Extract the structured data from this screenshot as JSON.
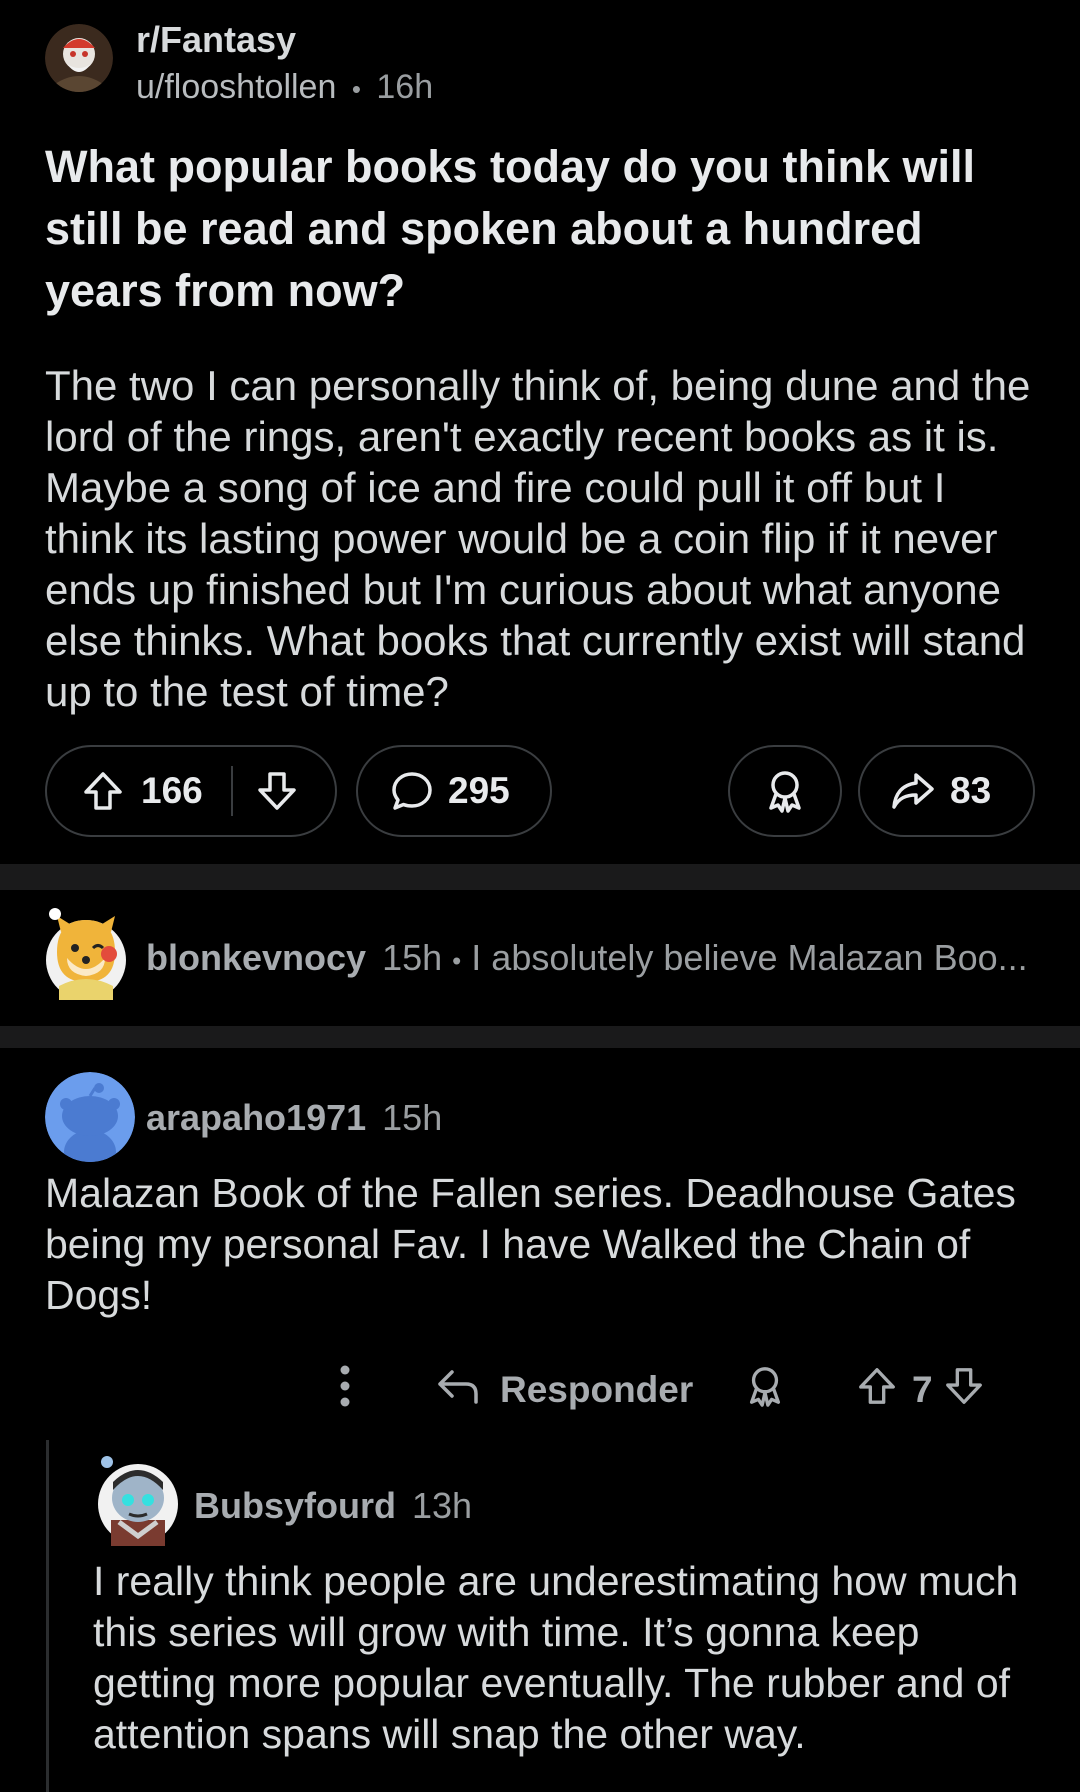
{
  "post": {
    "subreddit": "r/Fantasy",
    "author": "u/flooshtollen",
    "separator": "•",
    "time": "16h",
    "title": "What popular books today do you think will still be read and spoken about a hundred years from now?",
    "body": "The two I can personally think of, being dune and the lord of the rings, aren't exactly recent books as it is. Maybe a song of ice and fire could pull it off but I think its lasting power would be a coin flip if it never ends up finished but I'm curious about what anyone else thinks. What books that currently exist will stand up to the test of time?",
    "upvotes": "166",
    "comments": "295",
    "shares": "83"
  },
  "collapsed_comment": {
    "author": "blonkevnocy",
    "time": "15h",
    "separator": "•",
    "preview": "I absolutely believe Malazan Boo..."
  },
  "comment": {
    "author": "arapaho1971",
    "time": "15h",
    "text": "Malazan Book of the Fallen series. Deadhouse Gates being my personal Fav. I have Walked the Chain of Dogs!",
    "reply_label": "Responder",
    "votes": "7"
  },
  "reply": {
    "author": "Bubsyfourd",
    "time": "13h",
    "text": "I really think people are underestimating how much this series will grow with time. It’s gonna keep getting more popular eventually. The rubber and of attention spans will snap the other way."
  },
  "icons": {
    "upvote": "upvote-arrow-icon",
    "downvote": "downvote-arrow-icon",
    "comment": "comment-bubble-icon",
    "award": "award-icon",
    "share": "share-arrow-icon",
    "more": "more-vertical-icon",
    "reply": "reply-arrow-icon"
  },
  "colors": {
    "background": "#000000",
    "divider": "#1a1a1b",
    "text": "#d7dadc",
    "muted": "#9a9ea1",
    "pill_border": "#3a3d40",
    "avatar_blue": "#6b9ded"
  }
}
